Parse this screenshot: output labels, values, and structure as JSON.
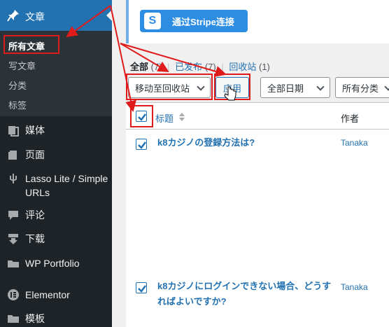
{
  "sidebar": {
    "posts_label": "文章",
    "submenu": [
      {
        "label": "所有文章",
        "current": true
      },
      {
        "label": "写文章",
        "current": false
      },
      {
        "label": "分类",
        "current": false
      },
      {
        "label": "标签",
        "current": false
      }
    ],
    "items": [
      {
        "label": "媒体",
        "icon": "media-icon"
      },
      {
        "label": "页面",
        "icon": "pages-icon"
      },
      {
        "label_line1": "Lasso Lite / Simple",
        "label_line2": "URLs",
        "icon": "lasso-icon"
      },
      {
        "label": "评论",
        "icon": "comments-icon"
      },
      {
        "label": "下载",
        "icon": "download-icon"
      },
      {
        "label": "WP Portfolio",
        "icon": "portfolio-icon"
      },
      {
        "label": "Elementor",
        "icon": "elementor-icon"
      },
      {
        "label": "模板",
        "icon": "templates-icon"
      }
    ]
  },
  "stripe": {
    "icon_letter": "S",
    "label": "通过Stripe连接"
  },
  "filters": {
    "all_label": "全部",
    "all_count": "(7)",
    "published_label": "已发布",
    "published_count": "(7)",
    "trash_label": "回收站",
    "trash_count": "(1)"
  },
  "bulk_action": {
    "selected": "移动至回收站",
    "apply_label": "应用"
  },
  "date_filter": {
    "selected": "全部日期"
  },
  "category_filter": {
    "selected": "所有分类"
  },
  "table": {
    "col_title": "标题",
    "col_author": "作者",
    "rows": [
      {
        "title": "k8カジノの登録方法は?",
        "author": "Tanaka",
        "checked": true
      },
      {
        "title": "k8カジノにログインできない場合、どうすればよいですか?",
        "author": "Tanaka",
        "checked": true
      }
    ]
  },
  "colors": {
    "accent": "#2271b1",
    "sidebar": "#1d2327",
    "highlight": "#e01b1b",
    "stripe": "#2c8de3"
  }
}
